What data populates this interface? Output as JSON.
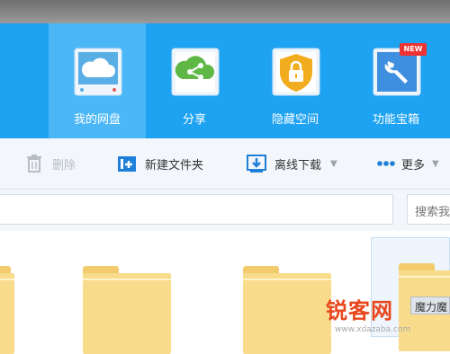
{
  "nav": {
    "items": [
      {
        "label": "我的网盘",
        "icon": "cloud-disk-icon"
      },
      {
        "label": "分享",
        "icon": "share-icon"
      },
      {
        "label": "隐藏空间",
        "icon": "lock-shield-icon"
      },
      {
        "label": "功能宝箱",
        "icon": "wrench-tool-icon",
        "badge": "NEW"
      }
    ]
  },
  "toolbar": {
    "delete_label": "删除",
    "new_folder_label": "新建文件夹",
    "offline_download_label": "离线下载",
    "more_label": "更多"
  },
  "search": {
    "placeholder": "搜索我"
  },
  "selected": {
    "chip_label": "魔力魔"
  },
  "watermark": {
    "text": "锐客网",
    "url": "www.xdazaba.com"
  },
  "colors": {
    "nav_bg": "#1ea2f2",
    "nav_active": "#4bb7f7",
    "toolbar_bg": "#f3f6fa",
    "folder": "#f8dc8b"
  }
}
